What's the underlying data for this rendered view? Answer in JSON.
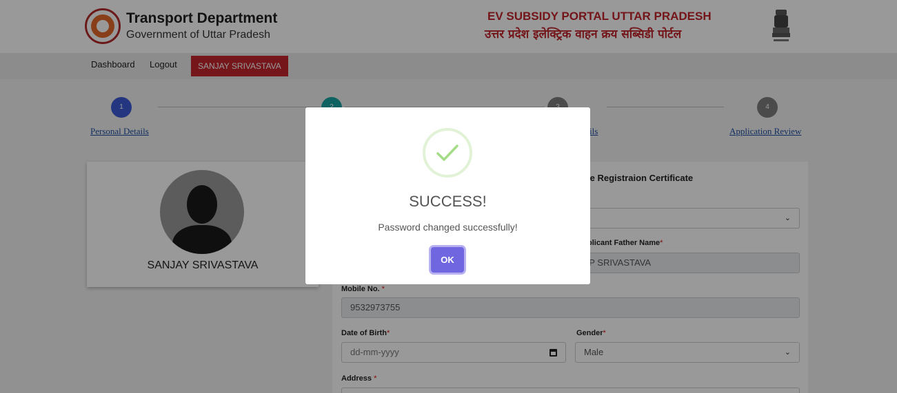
{
  "header": {
    "brand_title": "Transport Department",
    "brand_subtitle": "Government of Uttar Pradesh",
    "portal_title_en": "EV SUBSIDY PORTAL UTTAR PRADESH",
    "portal_title_hi": "उत्तर प्रदेश इलेक्ट्रिक वाहन क्रय सब्सिडी पोर्टल"
  },
  "nav": {
    "items": [
      {
        "label": "Dashboard"
      },
      {
        "label": "Logout"
      }
    ],
    "user": "SANJAY SRIVASTAVA"
  },
  "stepper": {
    "steps": [
      {
        "number": "1",
        "label": "Personal Details",
        "color": "#3f5ad8"
      },
      {
        "number": "2",
        "label": "",
        "color": "#1aa3a3"
      },
      {
        "number": "3",
        "label": "ils",
        "color": "#7d7d7d"
      },
      {
        "number": "4",
        "label": "Application Review",
        "color": "#7d7d7d"
      }
    ]
  },
  "profile": {
    "name": "SANJAY SRIVASTAVA"
  },
  "form": {
    "heading": "le Registraion Certificate",
    "father_label": "plicant Father Name",
    "father_value": "LP SRIVASTAVA",
    "mobile_label": "Mobile No.",
    "mobile_value": "9532973755",
    "dob_label": "Date of Birth",
    "dob_placeholder": "dd-mm-yyyy",
    "gender_label": "Gender",
    "gender_value": "Male",
    "address_label": "Address",
    "required_mark": "*"
  },
  "modal": {
    "title": "SUCCESS!",
    "message": "Password changed successfully!",
    "ok_label": "OK",
    "accent_color": "#7066e0",
    "check_color": "#a5dc86"
  }
}
